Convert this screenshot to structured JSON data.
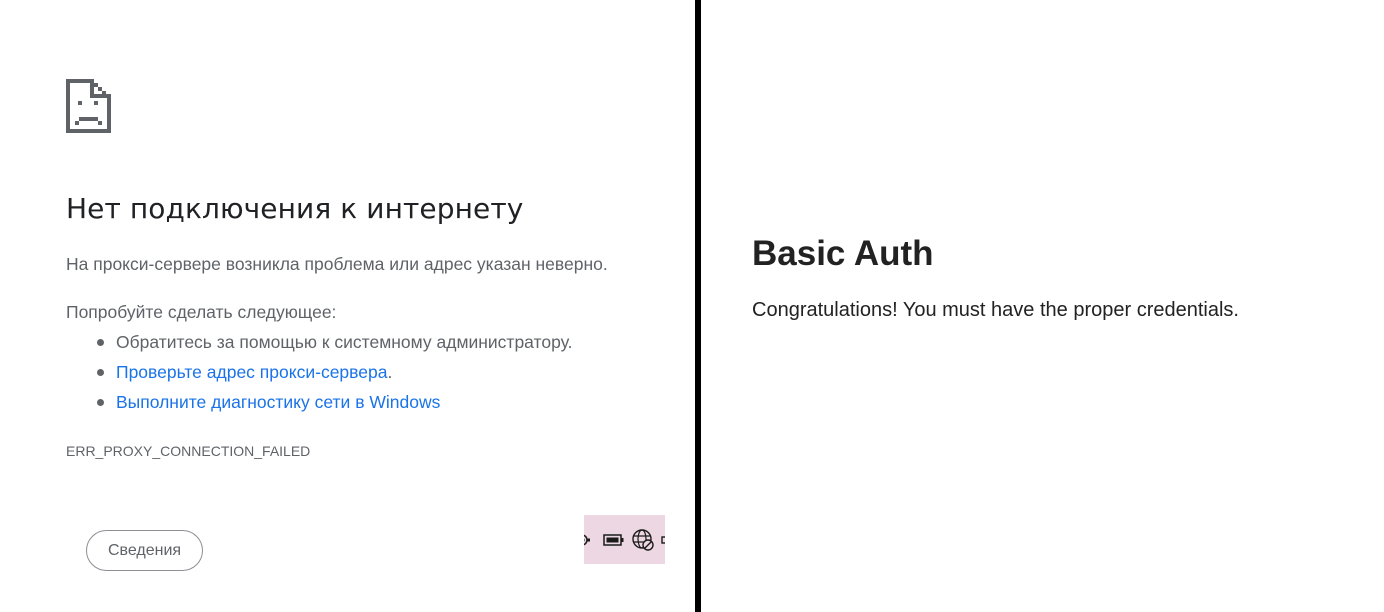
{
  "error_page": {
    "icon": "sad-document-icon",
    "title": "Нет подключения к интернету",
    "description": "На прокси-сервере возникла проблема или адрес указан неверно.",
    "suggestions_heading": "Попробуйте сделать следующее:",
    "suggestions": [
      {
        "text": "Обратитесь за помощью к системному администратору."
      },
      {
        "link": "Проверьте адрес прокси-сервера",
        "suffix": "."
      },
      {
        "link": "Выполните диагностику сети в Windows"
      }
    ],
    "error_code": "ERR_PROXY_CONNECTION_FAILED",
    "details_button": "Сведения",
    "colors": {
      "title": "#202124",
      "text": "#5f6368",
      "link": "#1a73e8",
      "tray_bg": "#ecd7e3"
    },
    "tray_icons": [
      "gear-icon",
      "battery-icon",
      "globe-blocked-icon",
      "speaker-icon"
    ]
  },
  "auth_page": {
    "title": "Basic Auth",
    "message": "Congratulations! You must have the proper credentials."
  }
}
